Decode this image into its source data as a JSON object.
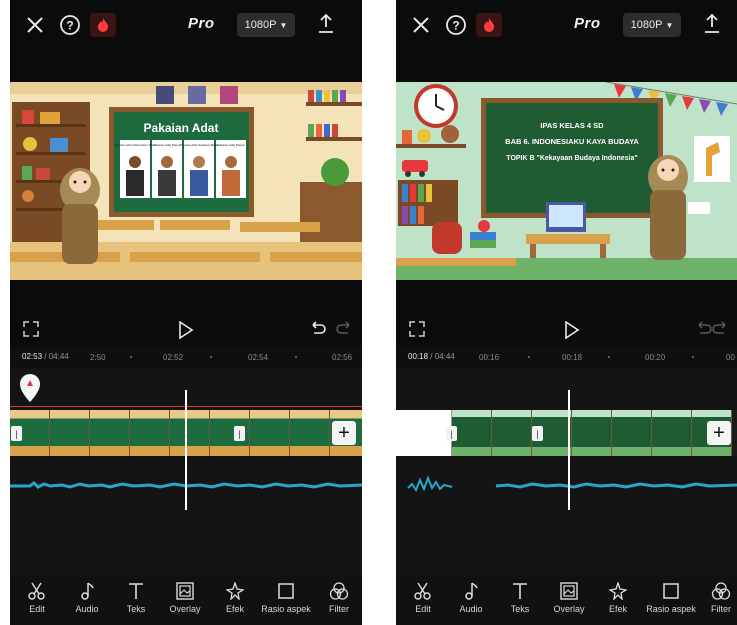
{
  "left": {
    "topbar": {
      "pro_label": "Pro",
      "resolution": "1080P"
    },
    "slide": {
      "board_title": "Pakaian Adat",
      "cards": [
        "Pakaian Adat Kalimantan Timur",
        "Pakaian Adat Papua",
        "Pakaian Adat Sulawesi Barat",
        "Pakaian Adat Papua"
      ]
    },
    "timeline": {
      "current": "02:53",
      "total": "/ 04:44",
      "ticks": [
        "2:50",
        "02:52",
        "02:54",
        "02:56"
      ]
    }
  },
  "right": {
    "topbar": {
      "pro_label": "Pro",
      "resolution": "1080P"
    },
    "slide": {
      "line1": "IPAS KELAS 4 SD",
      "line2": "BAB 6. INDONESIAKU KAYA BUDAYA",
      "line3": "TOPIK B \"Kekayaan Budaya Indonesia\""
    },
    "timeline": {
      "current": "00:18",
      "total": "/ 04:44",
      "ticks": [
        "00:16",
        "00:18",
        "00:20",
        "00"
      ]
    }
  },
  "toolbar": {
    "items": [
      {
        "label": "Edit",
        "icon": "scissors-icon"
      },
      {
        "label": "Audio",
        "icon": "music-note-icon"
      },
      {
        "label": "Teks",
        "icon": "text-icon"
      },
      {
        "label": "Overlay",
        "icon": "overlay-icon"
      },
      {
        "label": "Efek",
        "icon": "sparkle-icon"
      },
      {
        "label": "Rasio aspek",
        "icon": "aspect-ratio-icon"
      },
      {
        "label": "Filter",
        "icon": "filter-icon"
      }
    ]
  },
  "colors": {
    "accent_red": "#e6393d",
    "waveform": "#29a6c9",
    "board_green": "#1f6b40"
  }
}
